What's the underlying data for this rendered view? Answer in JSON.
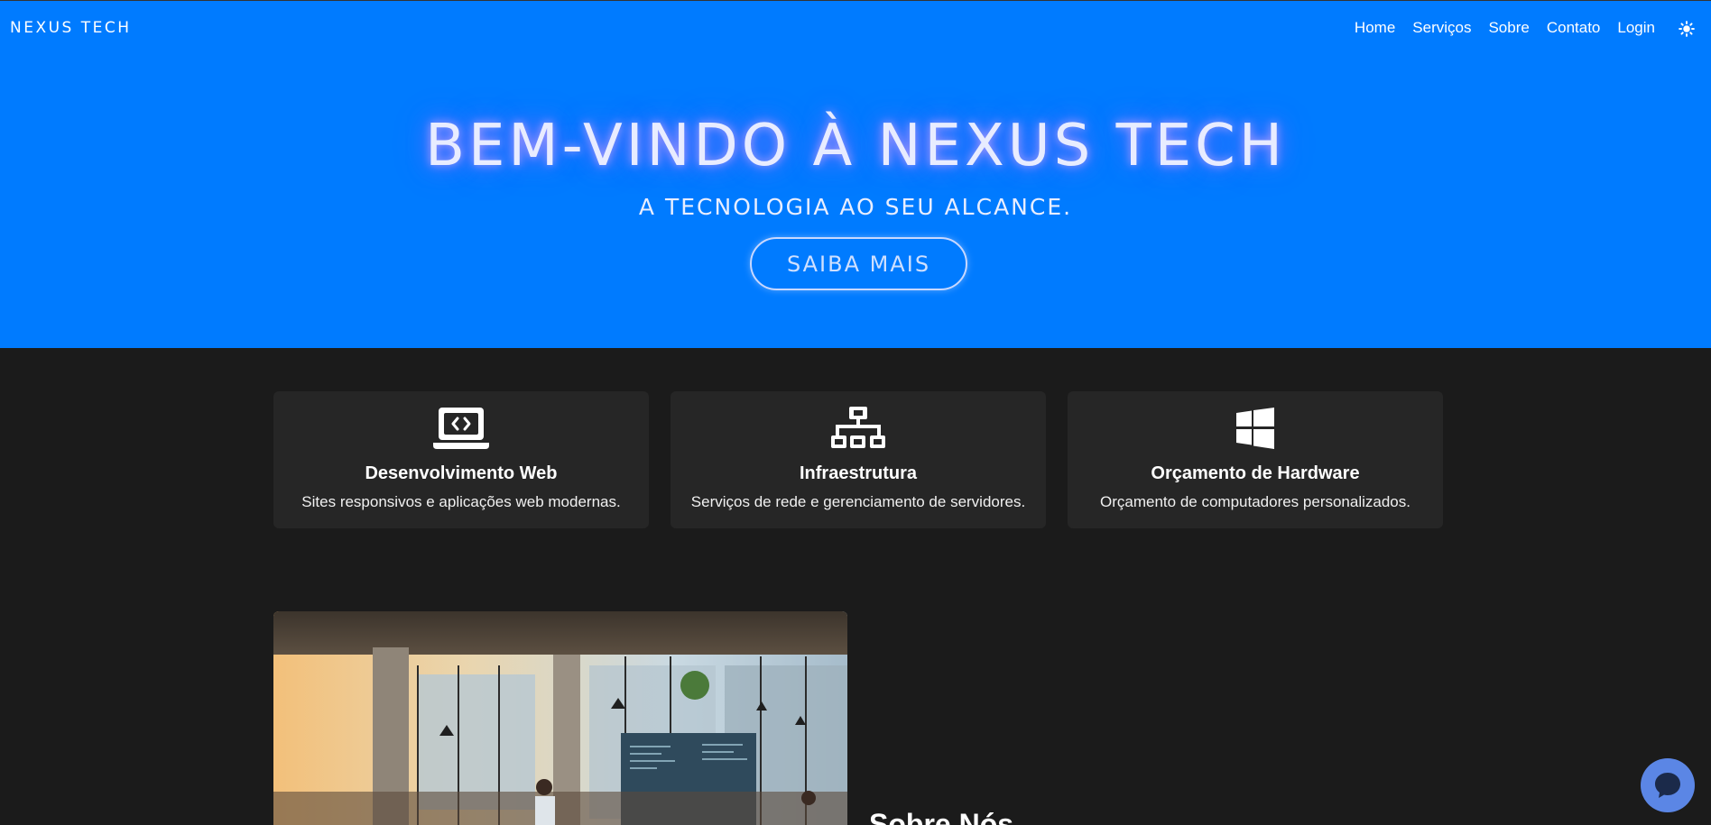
{
  "header": {
    "brand": "NEXUS TECH",
    "nav": [
      "Home",
      "Serviços",
      "Sobre",
      "Contato",
      "Login"
    ],
    "theme_toggle_icon": "sun-icon"
  },
  "hero": {
    "title": "BEM-VINDO À NEXUS TECH",
    "subtitle": "A TECNOLOGIA AO SEU ALCANCE.",
    "cta_label": "SAIBA MAIS",
    "background_color": "#007bff"
  },
  "services": [
    {
      "icon": "laptop-code-icon",
      "title": "Desenvolvimento Web",
      "description": "Sites responsivos e aplicações web modernas."
    },
    {
      "icon": "network-icon",
      "title": "Infraestrutura",
      "description": "Serviços de rede e gerenciamento de servidores."
    },
    {
      "icon": "windows-icon",
      "title": "Orçamento de Hardware",
      "description": "Orçamento de computadores personalizados."
    }
  ],
  "about": {
    "title": "Sobre Nós"
  },
  "chat": {
    "icon": "chat-icon",
    "color": "#5b86e5"
  },
  "colors": {
    "page_background": "#1b1b1b",
    "card_background": "#262626",
    "accent": "#007bff"
  }
}
